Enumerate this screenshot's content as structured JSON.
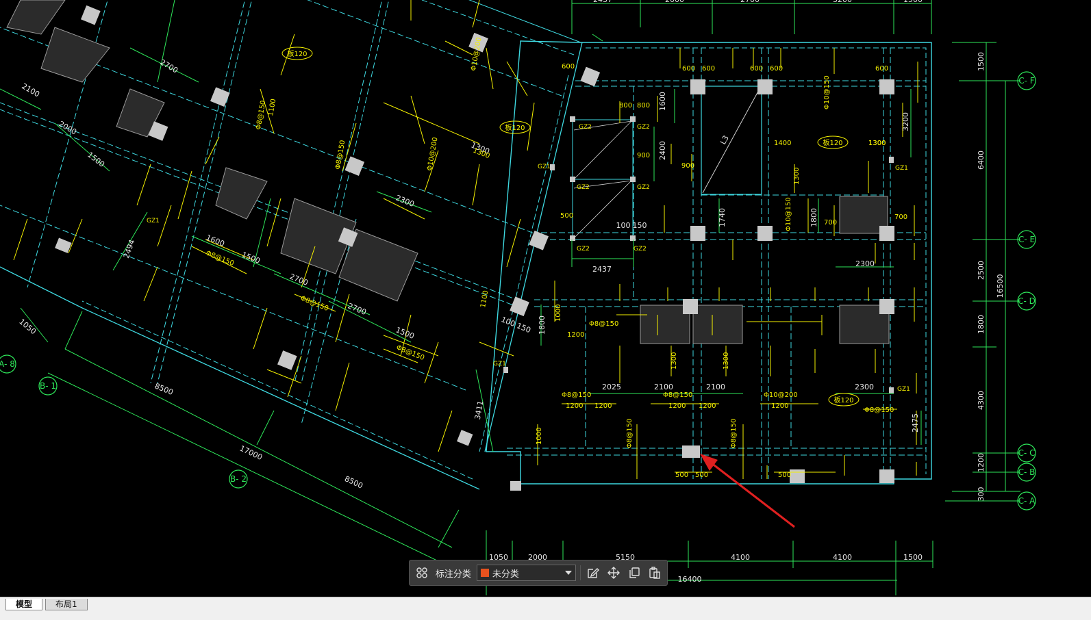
{
  "toolbar": {
    "category_label": "标注分类",
    "category_value": "未分类",
    "category_color": "#e8521e",
    "icons": [
      "grid-icon",
      "edit-icon",
      "move-icon",
      "copy-icon",
      "paste-icon"
    ]
  },
  "tabs": [
    {
      "label": "模型",
      "active": true
    },
    {
      "label": "布局1",
      "active": false
    }
  ],
  "drawing": {
    "axis_labels": {
      "cf": "C- F",
      "ce": "C- E",
      "cd": "C- D",
      "cc": "C- C",
      "cb": "C- B",
      "ca": "C- A",
      "b1": "B- 1",
      "b2": "B- 2",
      "a8": "A- 8"
    },
    "top_dims": [
      "2437",
      "2000",
      "2700",
      "3200",
      "1500"
    ],
    "bottom_dims": [
      "1050",
      "2000",
      "5150",
      "4100",
      "4100",
      "1500"
    ],
    "bottom_total": "16400",
    "right_dims": [
      "1500",
      "6400",
      "2500",
      "1800",
      "4300",
      "1200",
      "300"
    ],
    "right_total": "16500",
    "skew_dims": [
      "8500",
      "17000",
      "8500",
      "2700",
      "2700",
      "1500",
      "1600",
      "1500",
      "2100",
      "2000",
      "1500",
      "2700",
      "1300",
      "2300",
      "3411",
      "1050",
      "2494"
    ],
    "inner_dims": [
      "2437",
      "2025",
      "2100",
      "2100",
      "2300",
      "2300",
      "2475",
      "1740",
      "1800",
      "3200",
      "1600",
      "2400",
      "100",
      "150",
      "100 150",
      "1800"
    ],
    "slab_tags": [
      "板120",
      "板120",
      "板120",
      "板120"
    ],
    "rebar_notes": [
      "Φ8@150",
      "Φ10@200",
      "Φ8@150",
      "Φ10@150",
      "Φ8@150",
      "Φ8@150",
      "Φ10@200",
      "Φ8@150",
      "Φ8@150",
      "Φ8@150",
      "Φ8@150",
      "Φ10@200",
      "Φ8@150",
      "Φ8@150",
      "Φ8@150",
      "Φ10@150"
    ],
    "rebar_lengths": [
      "600",
      "600",
      "600",
      "600",
      "600",
      "600",
      "800",
      "800",
      "900",
      "900",
      "1300",
      "1200",
      "1200",
      "1200",
      "1200",
      "1200",
      "1200",
      "1000",
      "1000",
      "1400",
      "1300",
      "700",
      "700",
      "500",
      "500",
      "500",
      "500",
      "1100",
      "1100",
      "1300",
      "1300",
      "1300",
      "1300"
    ],
    "column_tags": [
      "GZ2",
      "GZ2",
      "GZ2",
      "GZ2",
      "GZ2",
      "GZ2",
      "GZ1",
      "GZ1",
      "GZ1",
      "GZ1",
      "GZ1"
    ],
    "stair_label": "L3"
  }
}
